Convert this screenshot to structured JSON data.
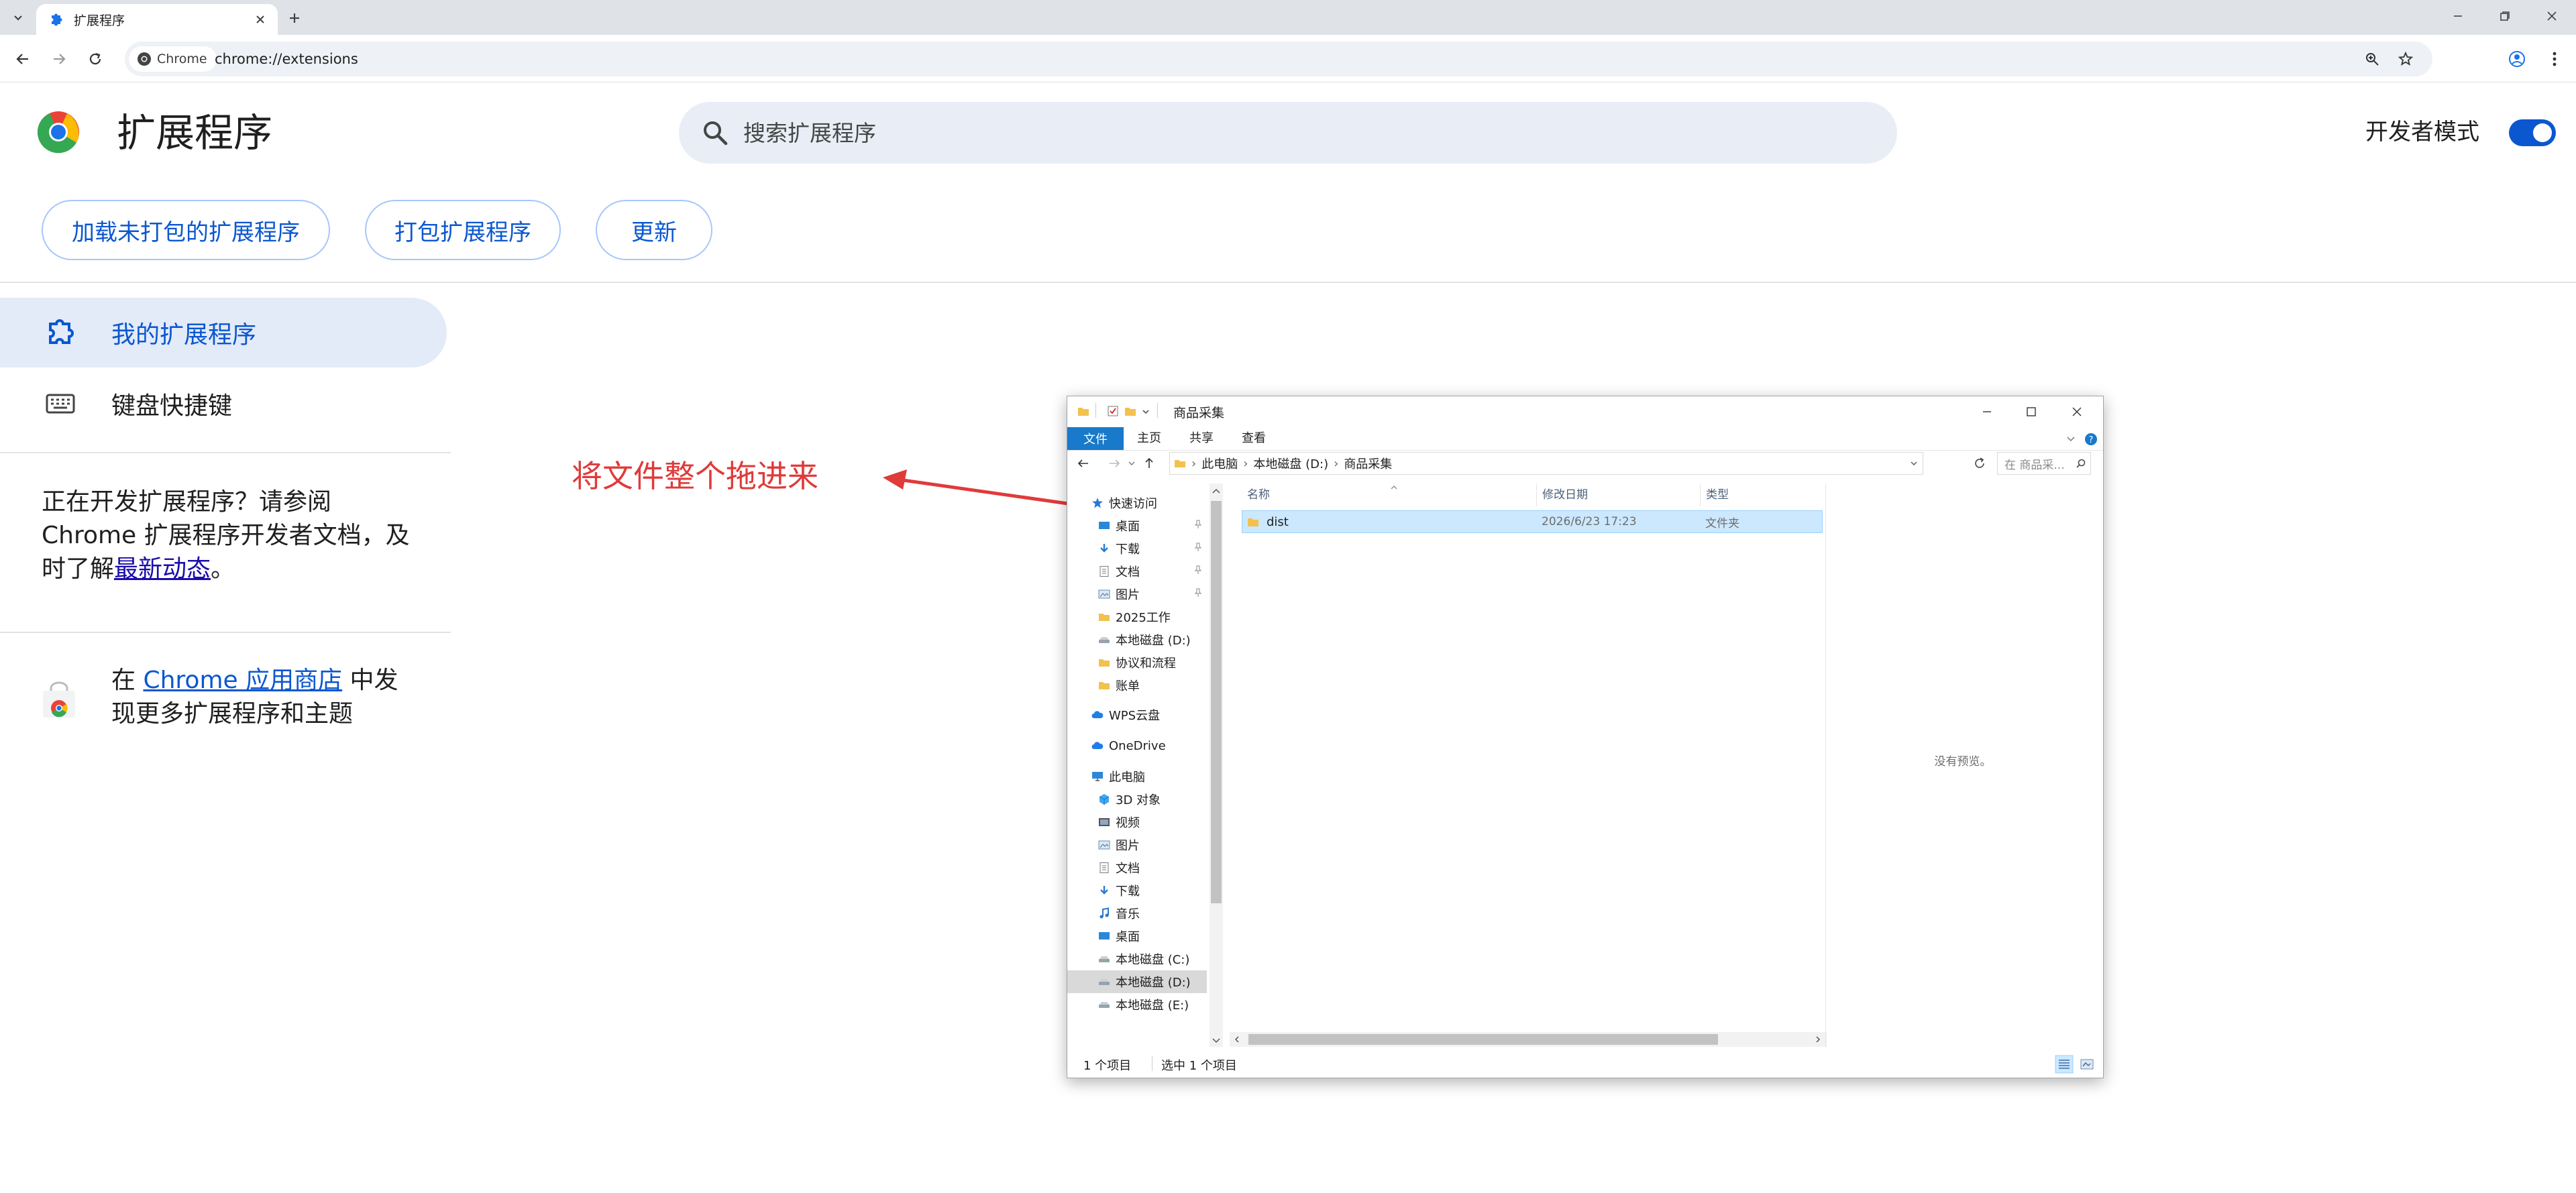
{
  "browser": {
    "tab_title": "扩展程序",
    "chip_label": "Chrome",
    "url": "chrome://extensions"
  },
  "page": {
    "title": "扩展程序",
    "search_placeholder": "搜索扩展程序",
    "dev_mode_label": "开发者模式",
    "dev_mode_on": true,
    "buttons": {
      "load_unpacked": "加载未打包的扩展程序",
      "pack": "打包扩展程序",
      "update": "更新"
    },
    "sidebar": {
      "my_extensions": "我的扩展程序",
      "shortcuts": "键盘快捷键"
    },
    "dev_note": {
      "text": "正在开发扩展程序？请参阅 Chrome 扩展程序开发者文档，及时了解",
      "link": "最新动态",
      "suffix": "。"
    },
    "store_note": {
      "prefix": "在 ",
      "link": "Chrome 应用商店",
      "suffix": " 中发现更多扩展程序和主题"
    }
  },
  "annotation": {
    "text": "将文件整个拖进来",
    "color": "#e03a3a"
  },
  "explorer": {
    "title": "商品采集",
    "ribbon": {
      "file": "文件",
      "home": "主页",
      "share": "共享",
      "view": "查看"
    },
    "breadcrumb": [
      "此电脑",
      "本地磁盘 (D:)",
      "商品采集"
    ],
    "search_placeholder": "在 商品采...",
    "nav": [
      {
        "label": "快速访问",
        "icon": "star-icon",
        "indent": 0,
        "pinned": false
      },
      {
        "label": "桌面",
        "icon": "desktop-icon",
        "indent": 1,
        "pinned": true
      },
      {
        "label": "下载",
        "icon": "download-icon",
        "indent": 1,
        "pinned": true
      },
      {
        "label": "文档",
        "icon": "document-icon",
        "indent": 1,
        "pinned": true
      },
      {
        "label": "图片",
        "icon": "picture-icon",
        "indent": 1,
        "pinned": true
      },
      {
        "label": "2025工作",
        "icon": "folder-icon",
        "indent": 1,
        "pinned": false
      },
      {
        "label": "本地磁盘 (D:)",
        "icon": "drive-icon",
        "indent": 1,
        "pinned": false
      },
      {
        "label": "协议和流程",
        "icon": "folder-icon",
        "indent": 1,
        "pinned": false
      },
      {
        "label": "账单",
        "icon": "folder-icon",
        "indent": 1,
        "pinned": false
      },
      {
        "label": "WPS云盘",
        "icon": "cloud-icon",
        "indent": 0,
        "pinned": false
      },
      {
        "label": "OneDrive",
        "icon": "cloud-icon",
        "indent": 0,
        "pinned": false
      },
      {
        "label": "此电脑",
        "icon": "computer-icon",
        "indent": 0,
        "pinned": false
      },
      {
        "label": "3D 对象",
        "icon": "cube-icon",
        "indent": 1,
        "pinned": false
      },
      {
        "label": "视频",
        "icon": "video-icon",
        "indent": 1,
        "pinned": false
      },
      {
        "label": "图片",
        "icon": "picture-icon",
        "indent": 1,
        "pinned": false
      },
      {
        "label": "文档",
        "icon": "document-icon",
        "indent": 1,
        "pinned": false
      },
      {
        "label": "下载",
        "icon": "download-icon",
        "indent": 1,
        "pinned": false
      },
      {
        "label": "音乐",
        "icon": "music-icon",
        "indent": 1,
        "pinned": false
      },
      {
        "label": "桌面",
        "icon": "desktop-icon",
        "indent": 1,
        "pinned": false
      },
      {
        "label": "本地磁盘 (C:)",
        "icon": "drive-icon",
        "indent": 1,
        "pinned": false
      },
      {
        "label": "本地磁盘 (D:)",
        "icon": "drive-icon",
        "indent": 1,
        "pinned": false,
        "selected": true
      },
      {
        "label": "本地磁盘 (E:)",
        "icon": "drive-icon",
        "indent": 1,
        "pinned": false
      }
    ],
    "columns": {
      "name": "名称",
      "date": "修改日期",
      "type": "类型"
    },
    "files": [
      {
        "name": "dist",
        "date": "2026/6/23 17:23",
        "type": "文件夹"
      }
    ],
    "preview_text": "没有预览。",
    "status": {
      "count": "1 个项目",
      "selected": "选中 1 个项目"
    }
  }
}
